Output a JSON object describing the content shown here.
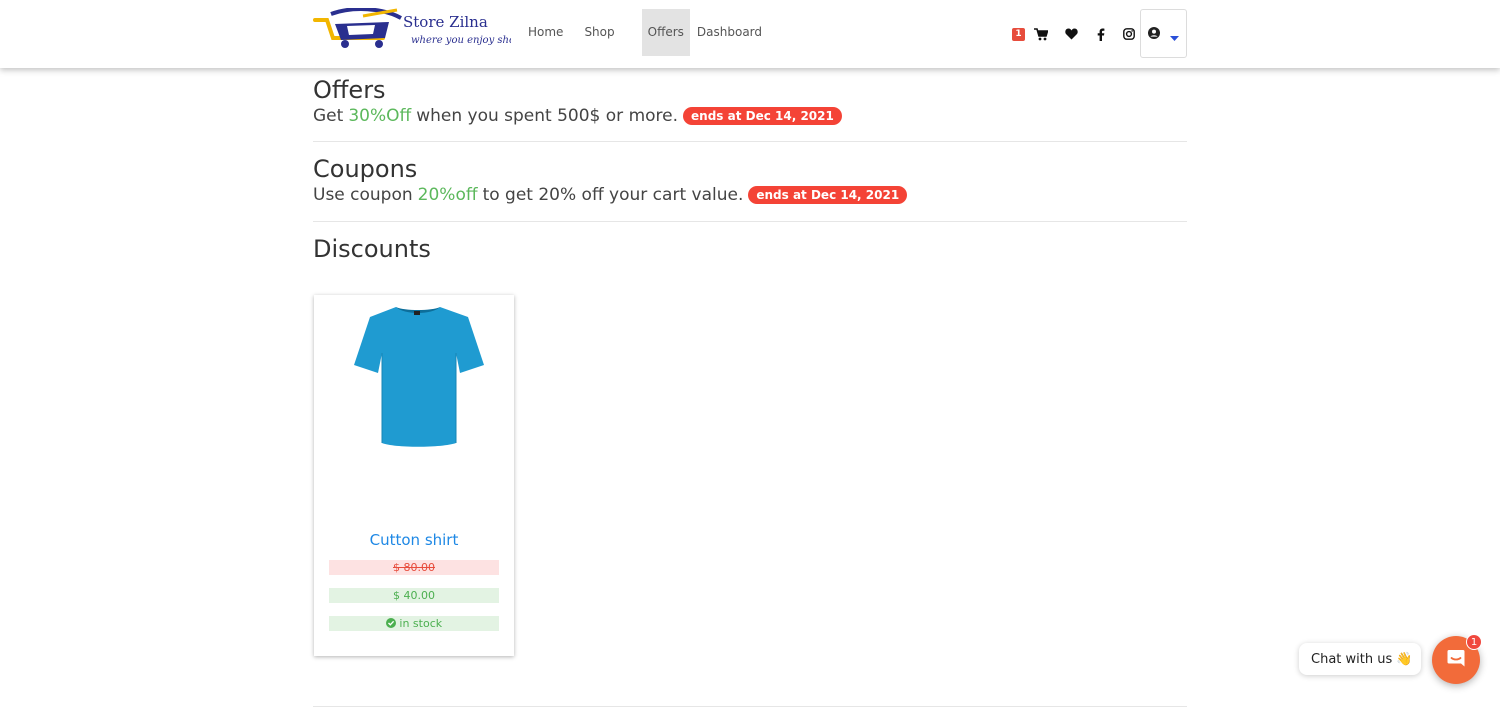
{
  "brand": {
    "logo_text": "Store Zilna",
    "tagline": "where you enjoy shopping"
  },
  "nav": {
    "links": [
      {
        "label": "Home",
        "active": false
      },
      {
        "label": "Shop",
        "active": false
      },
      {
        "label": "Offers",
        "active": true
      },
      {
        "label": "Dashboard",
        "active": false
      }
    ],
    "cart_count": "1",
    "icons": [
      "cart-icon",
      "heart-icon",
      "facebook-icon",
      "instagram-icon",
      "user-circle-icon",
      "caret-down-icon"
    ]
  },
  "offers": {
    "title": "Offers",
    "text_before": "Get",
    "highlight": "30%Off",
    "text_after": "when you spent 500$ or more.",
    "badge": "ends at Dec 14, 2021"
  },
  "coupons": {
    "title": "Coupons",
    "text_before": "Use coupon",
    "highlight": "20%off",
    "text_after": "to get 20% off your cart value.",
    "badge": "ends at Dec 14, 2021"
  },
  "discounts": {
    "title": "Discounts",
    "products": [
      {
        "name": "Cutton shirt",
        "old_price": "$ 80.00",
        "new_price": "$ 40.00",
        "stock": "in stock",
        "image": "blue t-shirt"
      }
    ]
  },
  "chat": {
    "label": "Chat with us",
    "emoji": "👋",
    "unread": "1"
  },
  "colors": {
    "accent_green": "#5cb85c",
    "badge_red": "#f44336",
    "link_blue": "#1e88e5",
    "chat_orange": "#f26b3a"
  }
}
